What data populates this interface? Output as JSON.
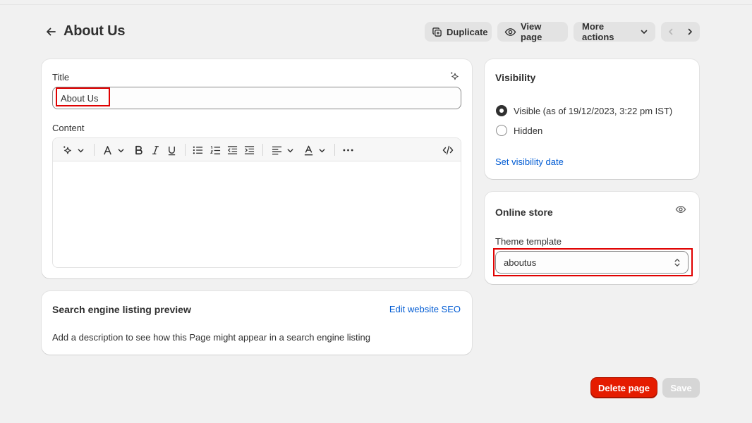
{
  "header": {
    "title": "About Us",
    "actions": {
      "duplicate": "Duplicate",
      "view_page": "View page",
      "more_actions": "More actions"
    }
  },
  "main": {
    "title_label": "Title",
    "title_value": "About Us",
    "content_label": "Content"
  },
  "seo": {
    "heading": "Search engine listing preview",
    "edit_link": "Edit website SEO",
    "description": "Add a description to see how this Page might appear in a search engine listing"
  },
  "visibility": {
    "heading": "Visibility",
    "options": [
      {
        "label": "Visible (as of 19/12/2023, 3:22 pm IST)",
        "selected": true
      },
      {
        "label": "Hidden",
        "selected": false
      }
    ],
    "set_date_link": "Set visibility date"
  },
  "online_store": {
    "heading": "Online store",
    "template_label": "Theme template",
    "template_value": "aboutus"
  },
  "footer": {
    "delete_label": "Delete page",
    "save_label": "Save"
  },
  "colors": {
    "background": "#f1f1f1",
    "link": "#005bd3",
    "danger": "#e51c00",
    "highlight": "#e00000"
  }
}
